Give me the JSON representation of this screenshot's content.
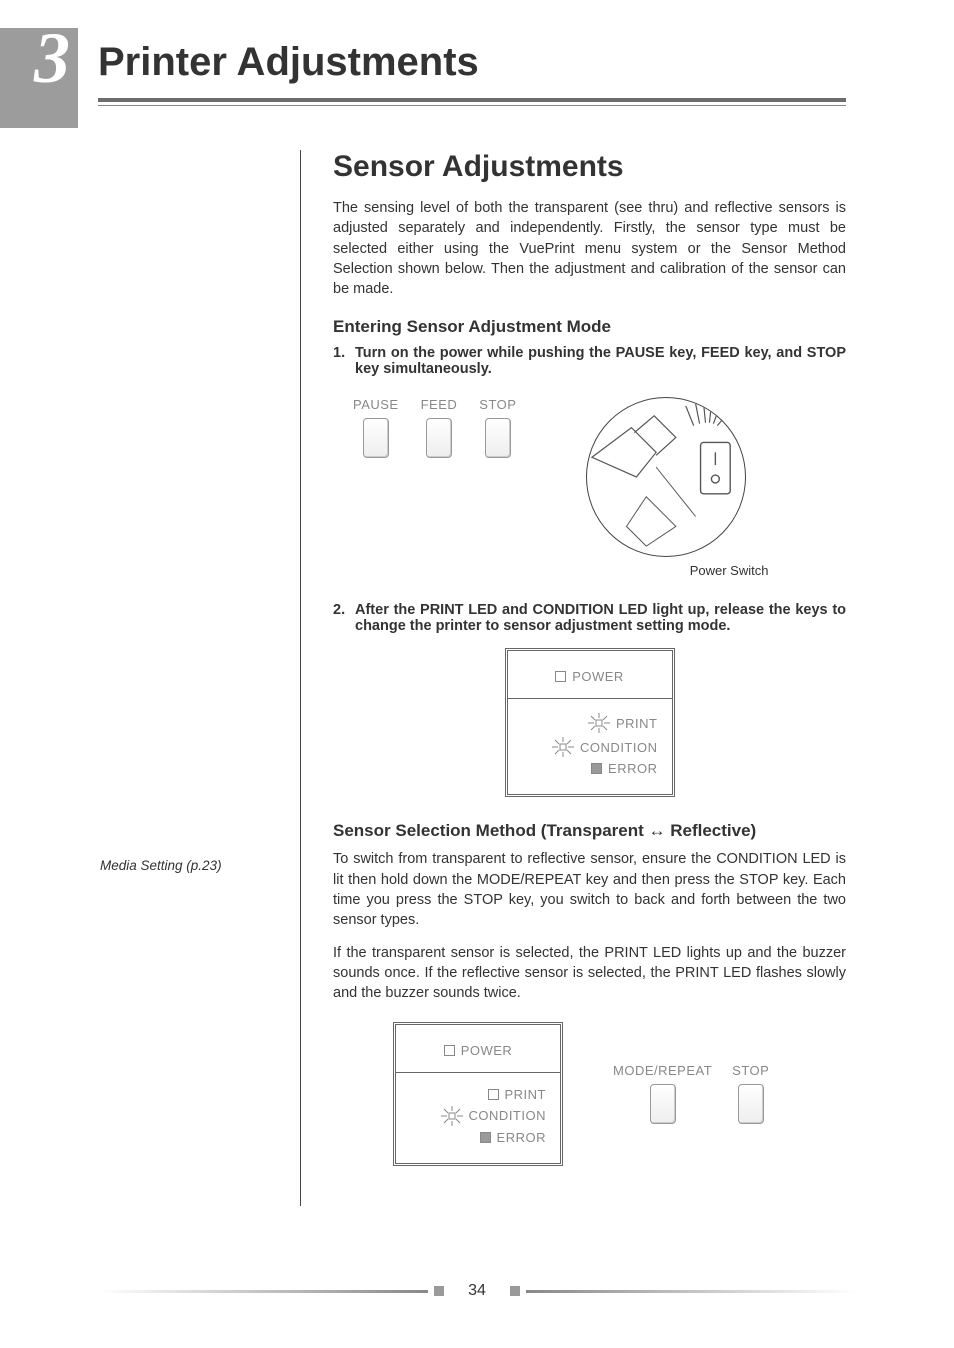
{
  "chapter": {
    "number": "3",
    "title": "Printer Adjustments"
  },
  "section": {
    "title": "Sensor Adjustments",
    "intro": "The sensing level of both the transparent (see thru) and reflective sensors is adjusted separately and independently. Firstly, the sensor type must be selected either using the VuePrint menu system or the Sensor Method Selection shown below. Then the adjustment and calibration of the sensor can be made.",
    "sub1": {
      "heading": "Entering Sensor Adjustment Mode",
      "step1": {
        "n": "1.",
        "text": "Turn on the power while pushing the PAUSE key, FEED key, and STOP key simultaneously."
      },
      "keys": {
        "pause": "PAUSE",
        "feed": "FEED",
        "stop": "STOP"
      },
      "switch_caption": "Power Switch",
      "step2": {
        "n": "2.",
        "text": "After the PRINT LED and CONDITION LED light up, release the keys to change the printer to sensor adjustment setting mode."
      }
    },
    "panel1": {
      "power": "POWER",
      "print": "PRINT",
      "condition": "CONDITION",
      "error": "ERROR"
    },
    "sub2": {
      "heading": "Sensor Selection Method (Transparent ↔ Reflective)",
      "p1": "To switch from transparent to reflective sensor, ensure the CONDITION LED is lit then hold down the MODE/REPEAT key and then press the STOP key. Each time you press the STOP key, you switch to back and forth between the two sensor types.",
      "p2": "If the transparent sensor is selected, the PRINT LED lights up and the buzzer sounds once.  If the reflective sensor is selected, the PRINT LED flashes slowly and the buzzer sounds twice."
    },
    "panel2": {
      "power": "POWER",
      "print": "PRINT",
      "condition": "CONDITION",
      "error": "ERROR"
    },
    "keys2": {
      "mode": "MODE/REPEAT",
      "stop": "STOP"
    }
  },
  "sidenote": "Media Setting (p.23)",
  "page_number": "34"
}
